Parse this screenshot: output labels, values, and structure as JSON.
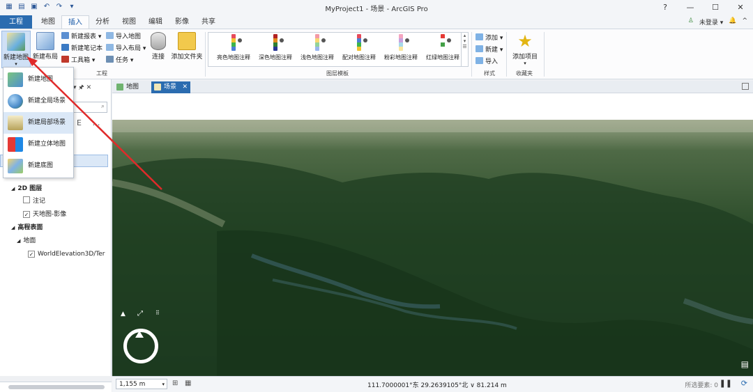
{
  "window": {
    "title": "MyProject1 - 场景 - ArcGIS Pro",
    "help": "?",
    "minimize": "—",
    "maximize": "☐",
    "close": "✕"
  },
  "qat": [
    "new-icon",
    "open-icon",
    "save-icon",
    "undo-icon",
    "redo-icon",
    "customize-icon"
  ],
  "tabs": {
    "file": "工程",
    "items": [
      "地图",
      "插入",
      "分析",
      "视图",
      "编辑",
      "影像",
      "共享"
    ],
    "active": "插入"
  },
  "user": {
    "signin": "未登录 ▾",
    "bell": "🔔",
    "pin": "^"
  },
  "ribbon": {
    "new_map": "新建地图",
    "new_layout": "新建布局",
    "new_report": "新建报表 ▾",
    "new_notebook": "新建笔记本",
    "toolbox": "工具箱 ▾",
    "import_map": "导入地图",
    "import_layout": "导入布局 ▾",
    "task": "任务 ▾",
    "connect": "连接",
    "add_folder": "添加文件夹",
    "project_group": "工程",
    "gallery": [
      {
        "label": "亮色地图注释",
        "colors": [
          "#e64a5a",
          "#f2c230",
          "#3cb44b",
          "#4d7fd6"
        ]
      },
      {
        "label": "深色地图注释",
        "colors": [
          "#b22222",
          "#e08a1e",
          "#2e7d32",
          "#283593"
        ]
      },
      {
        "label": "浅色地图注释",
        "colors": [
          "#f49aa5",
          "#f7d874",
          "#92d39a",
          "#9ab7ef"
        ]
      },
      {
        "label": "配对地图注释",
        "colors": [
          "#e64a5a",
          "#4d7fd6",
          "#3cb44b",
          "#f2c230"
        ]
      },
      {
        "label": "粉彩地图注释",
        "colors": [
          "#f4a6c0",
          "#c8a2e0",
          "#a8d8ea",
          "#f9e79f"
        ]
      },
      {
        "label": "红绿地图注释",
        "colors": [
          "#e53935",
          "#ffffff",
          "#43a047",
          "#ffffff"
        ]
      }
    ],
    "layer_template_group": "图层模板",
    "style_add": "添加 ▾",
    "style_new": "新建 ▾",
    "style_import": "导入",
    "style_group": "样式",
    "add_item": "添加项目",
    "favorites_group": "收藏夹"
  },
  "dropdown": [
    {
      "label": "新建地图",
      "highlight": false
    },
    {
      "label": "新建全局场景",
      "highlight": false
    },
    {
      "label": "新建局部场景",
      "highlight": true
    },
    {
      "label": "新建立体地图",
      "highlight": false
    },
    {
      "label": "新建底图",
      "highlight": false
    }
  ],
  "contents": {
    "pin": "▾ 🖈 ✕",
    "layers2d": "2D 图层",
    "annotation": "注记",
    "tianditu": "天地图-影像",
    "elevation": "高程表面",
    "ground": "地面",
    "world_elev": "WorldElevation3D/Ter"
  },
  "views": {
    "map_tab": "地图",
    "scene_tab": "场景",
    "close": "✕"
  },
  "status": {
    "scale": "1,155 m",
    "coords": "111.7000001°东  29.2639105°北  ∨  81.214 m",
    "selected": "所选要素: 0"
  }
}
